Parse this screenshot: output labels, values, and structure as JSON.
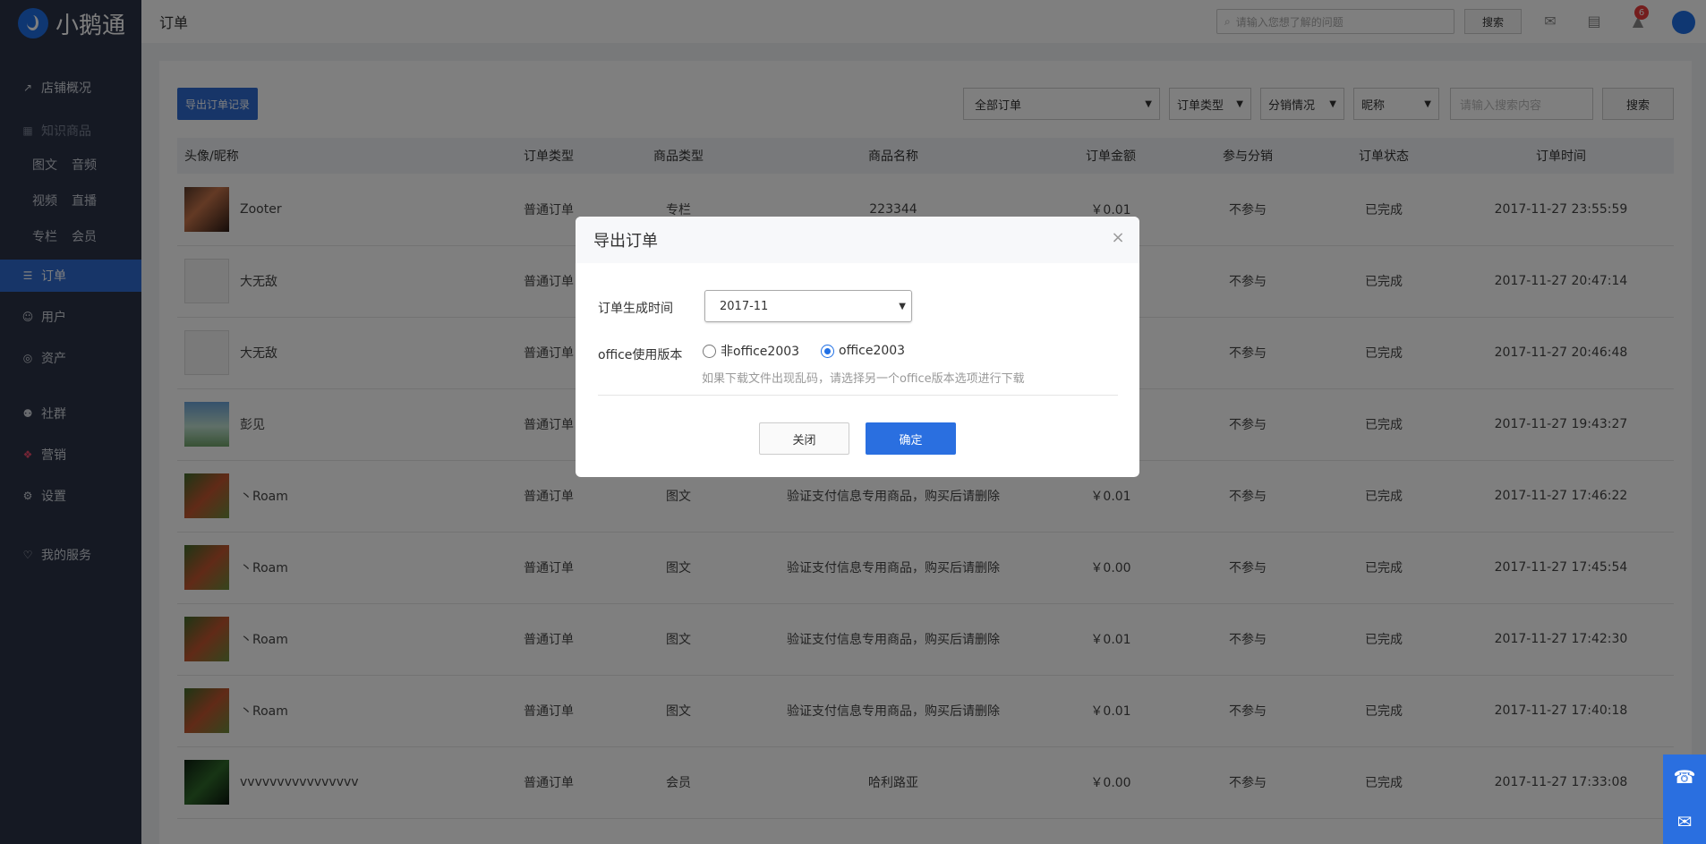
{
  "app": {
    "name": "小鹅通"
  },
  "sidebar": {
    "items": [
      {
        "label": "店铺概况",
        "icon": "chart-icon"
      },
      {
        "label": "知识商品",
        "icon": "grid-icon"
      },
      {
        "label": "订单",
        "icon": "order-icon"
      },
      {
        "label": "用户",
        "icon": "user-icon"
      },
      {
        "label": "资产",
        "icon": "coin-icon"
      },
      {
        "label": "社群",
        "icon": "group-icon"
      },
      {
        "label": "营销",
        "icon": "marketing-icon"
      },
      {
        "label": "设置",
        "icon": "gear-icon"
      },
      {
        "label": "我的服务",
        "icon": "heart-icon"
      }
    ],
    "sub": [
      [
        "图文",
        "音频"
      ],
      [
        "视频",
        "直播"
      ],
      [
        "专栏",
        "会员"
      ]
    ]
  },
  "topbar": {
    "title": "订单",
    "search_placeholder": "请输入您想了解的问题",
    "search_button": "搜索",
    "notification_count": "6"
  },
  "toolbar": {
    "export_label": "导出订单记录",
    "filter_all": "全部订单",
    "filter_type": "订单类型",
    "filter_distribution": "分销情况",
    "filter_nickname": "昵称",
    "search_placeholder": "请输入搜索内容",
    "search_button": "搜索"
  },
  "table": {
    "headers": [
      "头像/昵称",
      "订单类型",
      "商品类型",
      "商品名称",
      "订单金额",
      "参与分销",
      "订单状态",
      "订单时间"
    ],
    "rows": [
      {
        "nickname": "Zooter",
        "order_type": "普通订单",
        "product_type": "专栏",
        "product_name": "223344",
        "amount": "￥0.01",
        "distribution": "不参与",
        "status": "已完成",
        "time": "2017-11-27 23:55:59"
      },
      {
        "nickname": "大无敌",
        "order_type": "普通订单",
        "product_type": "",
        "product_name": "",
        "amount": "",
        "distribution": "不参与",
        "status": "已完成",
        "time": "2017-11-27 20:47:14"
      },
      {
        "nickname": "大无敌",
        "order_type": "普通订单",
        "product_type": "",
        "product_name": "",
        "amount": "",
        "distribution": "不参与",
        "status": "已完成",
        "time": "2017-11-27 20:46:48"
      },
      {
        "nickname": "彭见",
        "order_type": "普通订单",
        "product_type": "",
        "product_name": "",
        "amount": "",
        "distribution": "不参与",
        "status": "已完成",
        "time": "2017-11-27 19:43:27"
      },
      {
        "nickname": "丶Roam",
        "order_type": "普通订单",
        "product_type": "图文",
        "product_name": "验证支付信息专用商品，购买后请删除",
        "amount": "￥0.01",
        "distribution": "不参与",
        "status": "已完成",
        "time": "2017-11-27 17:46:22"
      },
      {
        "nickname": "丶Roam",
        "order_type": "普通订单",
        "product_type": "图文",
        "product_name": "验证支付信息专用商品，购买后请删除",
        "amount": "￥0.00",
        "distribution": "不参与",
        "status": "已完成",
        "time": "2017-11-27 17:45:54"
      },
      {
        "nickname": "丶Roam",
        "order_type": "普通订单",
        "product_type": "图文",
        "product_name": "验证支付信息专用商品，购买后请删除",
        "amount": "￥0.01",
        "distribution": "不参与",
        "status": "已完成",
        "time": "2017-11-27 17:42:30"
      },
      {
        "nickname": "丶Roam",
        "order_type": "普通订单",
        "product_type": "图文",
        "product_name": "验证支付信息专用商品，购买后请删除",
        "amount": "￥0.01",
        "distribution": "不参与",
        "status": "已完成",
        "time": "2017-11-27 17:40:18"
      },
      {
        "nickname": "vvvvvvvvvvvvvvvv",
        "order_type": "普通订单",
        "product_type": "会员",
        "product_name": "哈利路亚",
        "amount": "￥0.00",
        "distribution": "不参与",
        "status": "已完成",
        "time": "2017-11-27 17:33:08"
      }
    ]
  },
  "modal": {
    "title": "导出订单",
    "date_label": "订单生成时间",
    "date_value": "2017-11",
    "office_label": "office使用版本",
    "option_non2003": "非office2003",
    "option_2003": "office2003",
    "selected": "office2003",
    "hint": "如果下载文件出现乱码，请选择另一个office版本选项进行下载",
    "cancel_label": "关闭",
    "ok_label": "确定"
  },
  "colors": {
    "sidebar_bg": "#2a3247",
    "accent": "#2e6bd1",
    "price": "#e8403e"
  }
}
